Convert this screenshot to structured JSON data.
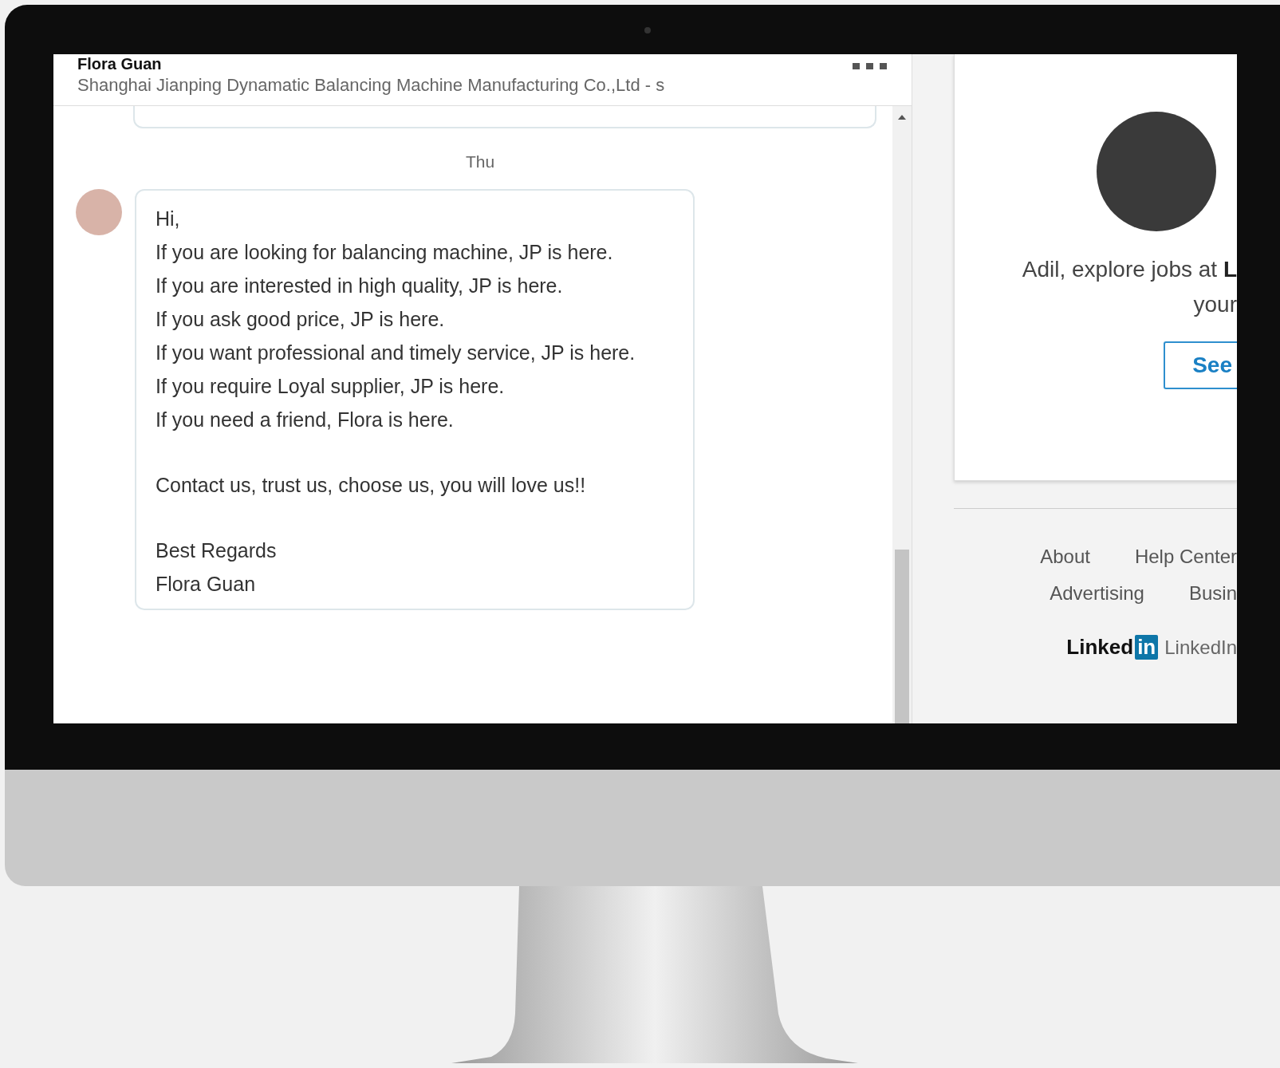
{
  "conversation": {
    "contact_name": "Flora Guan",
    "contact_company": "Shanghai Jianping Dynamatic Balancing Machine Manufacturing Co.,Ltd - s",
    "day_label": "Thu",
    "message": {
      "paragraphs": [
        [
          "Hi,",
          "If you are looking for balancing machine, JP is here.",
          "If you are interested in high quality, JP is here.",
          "If you ask good price, JP is here.",
          "If you want professional and timely service, JP is here.",
          "If you require Loyal supplier, JP is here.",
          "If you need a friend, Flora is here."
        ],
        [
          "Contact us, trust us, choose us, you will love us!!"
        ],
        [
          "Best Regards",
          "Flora Guan"
        ]
      ]
    }
  },
  "sidebar": {
    "promo": {
      "lines": [
        "Adil, explore jobs at **L**",
        "your"
      ],
      "button": "See"
    },
    "footer_links": [
      [
        "About",
        "Help Center"
      ],
      [
        "Advertising",
        "Busin"
      ]
    ],
    "logo": {
      "word": "Linked",
      "badge": "in"
    },
    "copyright": "LinkedIn"
  }
}
